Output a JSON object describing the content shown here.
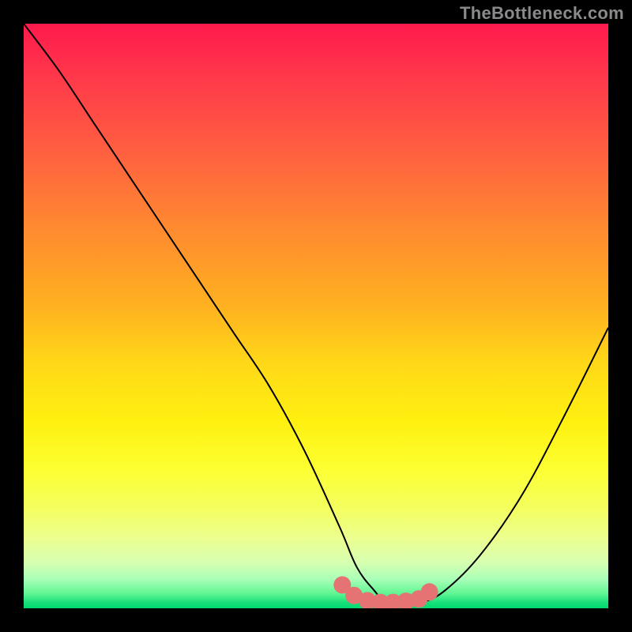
{
  "watermark": "TheBottleneck.com",
  "chart_data": {
    "type": "line",
    "title": "",
    "xlabel": "",
    "ylabel": "",
    "xlim": [
      0,
      100
    ],
    "ylim": [
      0,
      100
    ],
    "background_gradient": {
      "top": "#ff1a4d",
      "mid": "#ffe030",
      "bottom": "#00d870"
    },
    "series": [
      {
        "name": "bottleneck-curve",
        "color": "#000000",
        "x": [
          0,
          6,
          12,
          18,
          24,
          30,
          36,
          42,
          48,
          54,
          57,
          60,
          62,
          65,
          68,
          72,
          78,
          85,
          92,
          100
        ],
        "values": [
          100,
          92,
          83,
          74,
          65,
          56,
          47,
          38,
          27,
          14,
          7,
          3,
          1,
          1,
          1,
          3,
          9,
          19,
          32,
          48
        ]
      },
      {
        "name": "optimal-range-dots",
        "color": "#e57373",
        "x": [
          54.5,
          56.5,
          58.8,
          61.0,
          63.2,
          65.4,
          67.6,
          69.4
        ],
        "values": [
          4.0,
          2.2,
          1.3,
          1.0,
          1.0,
          1.2,
          1.6,
          2.8
        ]
      }
    ]
  }
}
